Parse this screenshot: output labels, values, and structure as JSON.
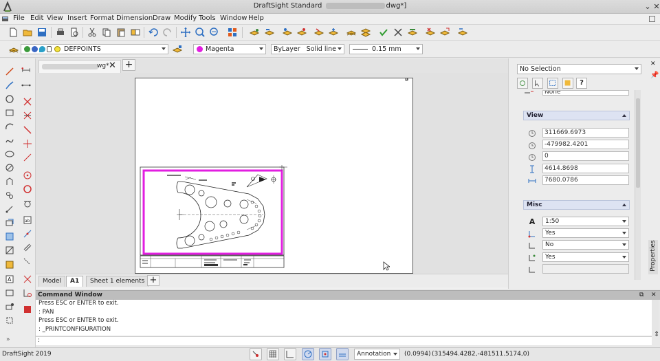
{
  "window": {
    "title_prefix": "DraftSight Standard",
    "title_suffix": "dwg*]"
  },
  "menu": [
    "File",
    "Edit",
    "View",
    "Insert",
    "Format",
    "Dimension",
    "Draw",
    "Modify",
    "Tools",
    "Window",
    "Help"
  ],
  "layer_bar": {
    "layer_name": "DEFPOINTS",
    "color_name": "Magenta",
    "linestyle_a": "ByLayer",
    "linestyle_b": "Solid line",
    "lineweight": "0.15 mm"
  },
  "document": {
    "tab_suffix": "wg*"
  },
  "layout_tabs": [
    "Model",
    "A1",
    "Sheet 1 elements"
  ],
  "properties": {
    "selection": "No Selection",
    "help_label": "?",
    "top_value": "None",
    "view_group": "View",
    "view_values": [
      "311669.6973",
      "-479982.4201",
      "0",
      "4614.8698",
      "7680.0786"
    ],
    "misc_group": "Misc",
    "misc_values": [
      "1:50",
      "Yes",
      "No",
      "Yes",
      ""
    ],
    "side_tab": "Properties"
  },
  "command_window": {
    "title": "Command Window",
    "lines": [
      "Press ESC or ENTER to exit.",
      ": PAN",
      "Press ESC or ENTER to exit.",
      ": _PRINTCONFIGURATION"
    ],
    "prompt": ":"
  },
  "status": {
    "app_version": "DraftSight 2019",
    "annotation": "Annotation",
    "scale_readout": "(0.0994)",
    "coords": "(315494.4282,-481511.5174,0)"
  },
  "colors": {
    "accent_magenta": "#e21ee0",
    "group_header": "#dde3f2"
  }
}
